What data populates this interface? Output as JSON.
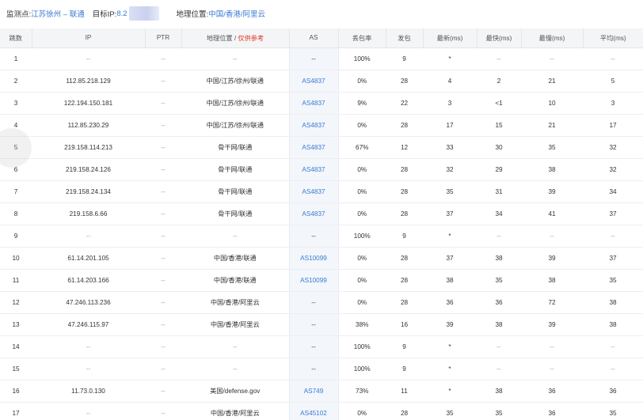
{
  "header": {
    "probe_label": "监测点:",
    "probe_value": "江苏徐州 – 联通",
    "target_label": "目标IP:",
    "target_value": "8.2",
    "geo_label": "地理位置:",
    "geo_value": "中国/香港/阿里云"
  },
  "columns": {
    "hop": "跳数",
    "ip": "IP",
    "ptr": "PTR",
    "geo": "地理位置 / ",
    "geo_hint": "仅供参考",
    "as": "AS",
    "loss": "丢包率",
    "sent": "发包",
    "last": "最新(ms)",
    "best": "最快(ms)",
    "worst": "最慢(ms)",
    "avg": "平均(ms)"
  },
  "rows": [
    {
      "hop": "1",
      "ip": "--",
      "ptr": "--",
      "geo": "--",
      "as": "--",
      "loss": "100%",
      "sent": "9",
      "last": "*",
      "best": "--",
      "worst": "--",
      "avg": "--"
    },
    {
      "hop": "2",
      "ip": "112.85.218.129",
      "ptr": "--",
      "geo": "中国/江苏/徐州/联通",
      "as": "AS4837",
      "loss": "0%",
      "sent": "28",
      "last": "4",
      "best": "2",
      "worst": "21",
      "avg": "5"
    },
    {
      "hop": "3",
      "ip": "122.194.150.181",
      "ptr": "--",
      "geo": "中国/江苏/徐州/联通",
      "as": "AS4837",
      "loss": "9%",
      "sent": "22",
      "last": "3",
      "best": "<1",
      "worst": "10",
      "avg": "3"
    },
    {
      "hop": "4",
      "ip": "112.85.230.29",
      "ptr": "--",
      "geo": "中国/江苏/徐州/联通",
      "as": "AS4837",
      "loss": "0%",
      "sent": "28",
      "last": "17",
      "best": "15",
      "worst": "21",
      "avg": "17"
    },
    {
      "hop": "5",
      "ip": "219.158.114.213",
      "ptr": "--",
      "geo": "骨干网/联通",
      "as": "AS4837",
      "loss": "67%",
      "sent": "12",
      "last": "33",
      "best": "30",
      "worst": "35",
      "avg": "32"
    },
    {
      "hop": "6",
      "ip": "219.158.24.126",
      "ptr": "--",
      "geo": "骨干网/联通",
      "as": "AS4837",
      "loss": "0%",
      "sent": "28",
      "last": "32",
      "best": "29",
      "worst": "38",
      "avg": "32"
    },
    {
      "hop": "7",
      "ip": "219.158.24.134",
      "ptr": "--",
      "geo": "骨干网/联通",
      "as": "AS4837",
      "loss": "0%",
      "sent": "28",
      "last": "35",
      "best": "31",
      "worst": "39",
      "avg": "34"
    },
    {
      "hop": "8",
      "ip": "219.158.6.66",
      "ptr": "--",
      "geo": "骨干网/联通",
      "as": "AS4837",
      "loss": "0%",
      "sent": "28",
      "last": "37",
      "best": "34",
      "worst": "41",
      "avg": "37"
    },
    {
      "hop": "9",
      "ip": "--",
      "ptr": "--",
      "geo": "--",
      "as": "--",
      "loss": "100%",
      "sent": "9",
      "last": "*",
      "best": "--",
      "worst": "--",
      "avg": "--"
    },
    {
      "hop": "10",
      "ip": "61.14.201.105",
      "ptr": "--",
      "geo": "中国/香港/联通",
      "as": "AS10099",
      "loss": "0%",
      "sent": "28",
      "last": "37",
      "best": "38",
      "worst": "39",
      "avg": "37"
    },
    {
      "hop": "11",
      "ip": "61.14.203.166",
      "ptr": "--",
      "geo": "中国/香港/联通",
      "as": "AS10099",
      "loss": "0%",
      "sent": "28",
      "last": "38",
      "best": "35",
      "worst": "38",
      "avg": "35"
    },
    {
      "hop": "12",
      "ip": "47.246.113.236",
      "ptr": "--",
      "geo": "中国/香港/阿里云",
      "as": "--",
      "loss": "0%",
      "sent": "28",
      "last": "36",
      "best": "36",
      "worst": "72",
      "avg": "38"
    },
    {
      "hop": "13",
      "ip": "47.246.115.97",
      "ptr": "--",
      "geo": "中国/香港/阿里云",
      "as": "--",
      "loss": "38%",
      "sent": "16",
      "last": "39",
      "best": "38",
      "worst": "39",
      "avg": "38"
    },
    {
      "hop": "14",
      "ip": "--",
      "ptr": "--",
      "geo": "--",
      "as": "--",
      "loss": "100%",
      "sent": "9",
      "last": "*",
      "best": "--",
      "worst": "--",
      "avg": "--"
    },
    {
      "hop": "15",
      "ip": "--",
      "ptr": "--",
      "geo": "--",
      "as": "--",
      "loss": "100%",
      "sent": "9",
      "last": "*",
      "best": "--",
      "worst": "--",
      "avg": "--"
    },
    {
      "hop": "16",
      "ip": "11.73.0.130",
      "ptr": "--",
      "geo": "美国/defense.gov",
      "as": "AS749",
      "loss": "73%",
      "sent": "11",
      "last": "*",
      "best": "38",
      "worst": "36",
      "avg": "36"
    },
    {
      "hop": "17",
      "ip": "--",
      "ptr": "--",
      "geo": "中国/香港/阿里云",
      "as": "AS45102",
      "loss": "0%",
      "sent": "28",
      "last": "35",
      "best": "35",
      "worst": "36",
      "avg": "35"
    }
  ],
  "colors": {
    "accent": "#3a7bd5",
    "hint": "#e0321f",
    "header_bg": "#f4f5f7",
    "as_cell_bg": "#f3f6fb"
  }
}
